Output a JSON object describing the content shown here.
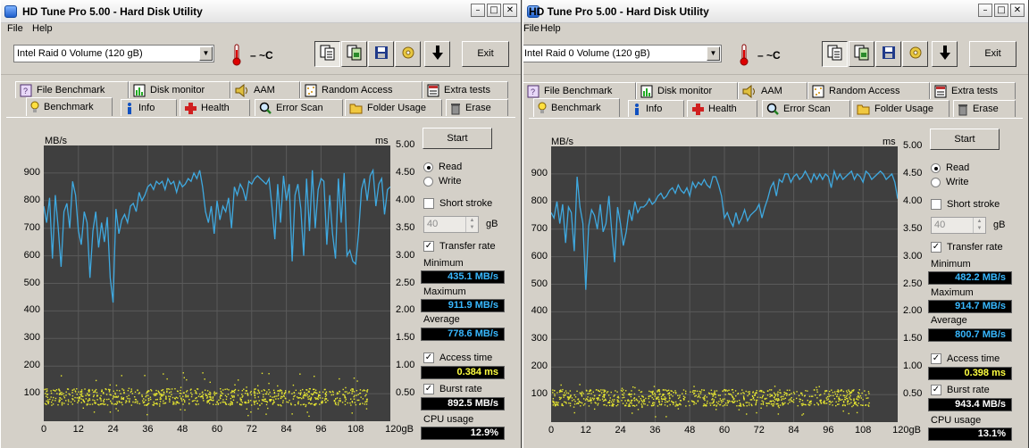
{
  "windows": [
    {
      "title": "HD Tune Pro 5.00 - Hard Disk Utility",
      "menu": [
        "File",
        "Help"
      ],
      "drive": "Intel   Raid 0 Volume (120 gB)",
      "temperature": "– ~C",
      "exit_label": "Exit",
      "tabs_top": [
        "File Benchmark",
        "Disk monitor",
        "AAM",
        "Random Access",
        "Extra tests"
      ],
      "tabs_bottom": [
        "Benchmark",
        "Info",
        "Health",
        "Error Scan",
        "Folder Usage",
        "Erase"
      ],
      "start_label": "Start",
      "read_label": "Read",
      "write_label": "Write",
      "short_stroke_label": "Short stroke",
      "short_stroke_value": "40",
      "gb_label": "gB",
      "transfer_rate_label": "Transfer rate",
      "minimum_label": "Minimum",
      "minimum_value": "435.1 MB/s",
      "maximum_label": "Maximum",
      "maximum_value": "911.9 MB/s",
      "average_label": "Average",
      "average_value": "778.6 MB/s",
      "access_time_label": "Access time",
      "access_time_value": "0.384 ms",
      "burst_rate_label": "Burst rate",
      "burst_rate_value": "892.5 MB/s",
      "cpu_usage_label": "CPU usage",
      "cpu_usage_value": "12.9%"
    },
    {
      "title": "HD Tune Pro 5.00 - Hard Disk Utility",
      "menu": [
        "File",
        "Help"
      ],
      "drive": "Intel   Raid 0 Volume (120 gB)",
      "temperature": "– ~C",
      "exit_label": "Exit",
      "tabs_top": [
        "File Benchmark",
        "Disk monitor",
        "AAM",
        "Random Access",
        "Extra tests"
      ],
      "tabs_bottom": [
        "Benchmark",
        "Info",
        "Health",
        "Error Scan",
        "Folder Usage",
        "Erase"
      ],
      "start_label": "Start",
      "read_label": "Read",
      "write_label": "Write",
      "short_stroke_label": "Short stroke",
      "short_stroke_value": "40",
      "gb_label": "gB",
      "transfer_rate_label": "Transfer rate",
      "minimum_label": "Minimum",
      "minimum_value": "482.2 MB/s",
      "maximum_label": "Maximum",
      "maximum_value": "914.7 MB/s",
      "average_label": "Average",
      "average_value": "800.7 MB/s",
      "access_time_label": "Access time",
      "access_time_value": "0.398 ms",
      "burst_rate_label": "Burst rate",
      "burst_rate_value": "943.4 MB/s",
      "cpu_usage_label": "CPU usage",
      "cpu_usage_value": "13.1%"
    }
  ],
  "colors": {
    "transfer_line": "#3fa9e0",
    "access_dots": "#e8e830",
    "plot_bg": "#3f3f3f",
    "grid": "#5a5a5a"
  },
  "chart_data": [
    {
      "type": "line",
      "ylabel_left": "MB/s",
      "ylabel_right": "ms",
      "xlabel_unit": "gB",
      "ylim_left": [
        0,
        1000
      ],
      "ylim_right": [
        0,
        5
      ],
      "xlim": [
        0,
        120
      ],
      "y_ticks_left": [
        "100",
        "200",
        "300",
        "400",
        "500",
        "600",
        "700",
        "800",
        "900",
        "1000"
      ],
      "y_ticks_right": [
        "0.50",
        "1.00",
        "1.50",
        "2.00",
        "2.50",
        "3.00",
        "3.50",
        "4.00",
        "4.50",
        "5.00"
      ],
      "x_ticks": [
        "0",
        "12",
        "24",
        "36",
        "48",
        "60",
        "72",
        "84",
        "96",
        "108",
        "120gB"
      ],
      "grid": true,
      "series": [
        {
          "x": [
            0,
            1,
            2,
            3,
            4,
            5,
            6,
            7,
            8,
            9,
            10,
            11,
            12,
            13,
            14,
            15,
            16,
            17,
            18,
            19,
            20,
            21,
            22,
            23,
            24,
            25,
            26,
            27,
            28,
            29,
            30,
            31,
            32,
            33,
            34,
            35,
            36,
            37,
            38,
            39,
            40,
            41,
            42,
            43,
            44,
            45,
            46,
            47,
            48,
            49,
            50,
            51,
            52,
            53,
            54,
            55,
            56,
            57,
            58,
            59,
            60,
            61,
            62,
            63,
            64,
            65,
            66,
            67,
            68,
            69,
            70,
            71,
            72,
            73,
            74,
            75,
            76,
            77,
            78,
            79,
            80,
            81,
            82,
            83,
            84,
            85,
            86,
            87,
            88,
            89,
            90,
            91,
            92,
            93,
            94,
            95,
            96,
            97,
            98,
            99,
            100,
            101,
            102,
            103,
            104,
            105,
            106,
            107,
            108,
            109,
            110,
            111,
            112,
            113,
            114,
            115,
            116,
            117,
            118,
            119,
            120
          ],
          "values": [
            780,
            720,
            810,
            590,
            820,
            700,
            560,
            760,
            790,
            700,
            870,
            820,
            690,
            640,
            760,
            720,
            520,
            690,
            760,
            630,
            720,
            650,
            740,
            520,
            430,
            770,
            680,
            730,
            750,
            720,
            780,
            790,
            760,
            830,
            800,
            820,
            850,
            860,
            840,
            870,
            860,
            870,
            840,
            880,
            860,
            870,
            830,
            870,
            850,
            860,
            880,
            870,
            900,
            880,
            910,
            850,
            760,
            720,
            780,
            680,
            800,
            730,
            780,
            760,
            810,
            700,
            850,
            820,
            860,
            840,
            800,
            870,
            860,
            880,
            890,
            880,
            870,
            860,
            880,
            780,
            660,
            860,
            720,
            890,
            800,
            860,
            580,
            820,
            860,
            770,
            600,
            880,
            690,
            910,
            700,
            840,
            880,
            870,
            640,
            820,
            680,
            590,
            880,
            720,
            900,
            600,
            620,
            580,
            570,
            680,
            840,
            880,
            800,
            890,
            910,
            780,
            860,
            880,
            750,
            840,
            850
          ]
        }
      ],
      "access_time_ms": {
        "min": 0.1,
        "max": 0.9,
        "typical": 0.45
      }
    },
    {
      "type": "line",
      "ylabel_left": "MB/s",
      "ylabel_right": "ms",
      "xlabel_unit": "gB",
      "ylim_left": [
        0,
        1000
      ],
      "ylim_right": [
        0,
        5
      ],
      "xlim": [
        0,
        120
      ],
      "y_ticks_left": [
        "100",
        "200",
        "300",
        "400",
        "500",
        "600",
        "700",
        "800",
        "900",
        "1000"
      ],
      "y_ticks_right": [
        "0.50",
        "1.00",
        "1.50",
        "2.00",
        "2.50",
        "3.00",
        "3.50",
        "4.00",
        "4.50",
        "5.00"
      ],
      "x_ticks": [
        "0",
        "12",
        "24",
        "36",
        "48",
        "60",
        "72",
        "84",
        "96",
        "108",
        "120gB"
      ],
      "grid": true,
      "series": [
        {
          "x": [
            0,
            1,
            2,
            3,
            4,
            5,
            6,
            7,
            8,
            9,
            10,
            11,
            12,
            13,
            14,
            15,
            16,
            17,
            18,
            19,
            20,
            21,
            22,
            23,
            24,
            25,
            26,
            27,
            28,
            29,
            30,
            31,
            32,
            33,
            34,
            35,
            36,
            37,
            38,
            39,
            40,
            41,
            42,
            43,
            44,
            45,
            46,
            47,
            48,
            49,
            50,
            51,
            52,
            53,
            54,
            55,
            56,
            57,
            58,
            59,
            60,
            61,
            62,
            63,
            64,
            65,
            66,
            67,
            68,
            69,
            70,
            71,
            72,
            73,
            74,
            75,
            76,
            77,
            78,
            79,
            80,
            81,
            82,
            83,
            84,
            85,
            86,
            87,
            88,
            89,
            90,
            91,
            92,
            93,
            94,
            95,
            96,
            97,
            98,
            99,
            100,
            101,
            102,
            103,
            104,
            105,
            106,
            107,
            108,
            109,
            110,
            111,
            112,
            113,
            114,
            115,
            116,
            117,
            118,
            119,
            120
          ],
          "values": [
            760,
            740,
            800,
            720,
            790,
            650,
            780,
            760,
            620,
            890,
            780,
            720,
            480,
            710,
            770,
            750,
            700,
            790,
            690,
            720,
            820,
            690,
            580,
            780,
            720,
            640,
            690,
            770,
            730,
            800,
            760,
            780,
            780,
            790,
            810,
            790,
            800,
            820,
            830,
            810,
            820,
            840,
            850,
            830,
            860,
            840,
            830,
            850,
            820,
            870,
            850,
            870,
            860,
            880,
            860,
            850,
            890,
            890,
            860,
            820,
            740,
            760,
            730,
            710,
            760,
            720,
            740,
            770,
            730,
            750,
            760,
            770,
            790,
            740,
            780,
            810,
            850,
            870,
            820,
            880,
            870,
            900,
            900,
            870,
            890,
            900,
            880,
            890,
            910,
            890,
            870,
            900,
            880,
            900,
            880,
            900,
            890,
            850,
            910,
            880,
            900,
            880,
            890,
            900,
            910,
            880,
            900,
            890,
            870,
            910,
            900,
            880,
            890,
            900,
            910,
            900,
            880,
            890,
            900,
            870,
            810
          ]
        }
      ],
      "access_time_ms": {
        "min": 0.1,
        "max": 0.7,
        "typical": 0.45
      }
    }
  ]
}
